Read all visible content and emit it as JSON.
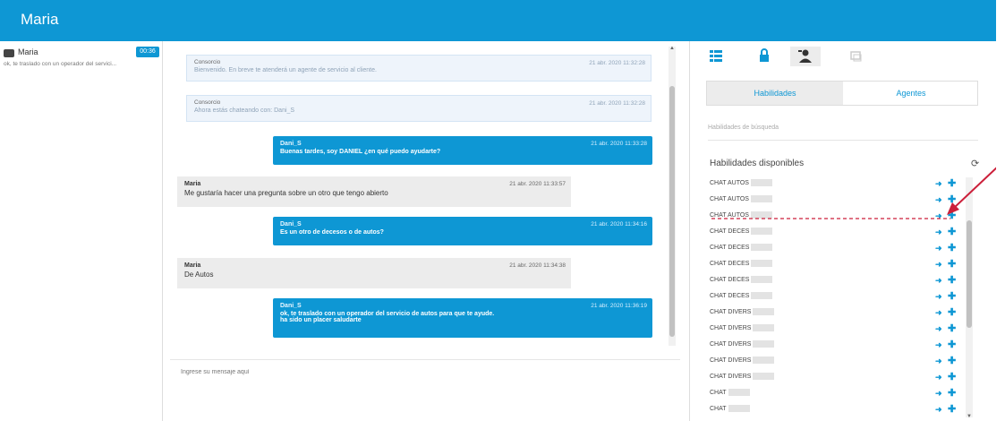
{
  "app": {
    "title": "Maria",
    "accent": "#0e97d4",
    "annotation_color": "#cc1f3a"
  },
  "conversations": [
    {
      "name": "Maria",
      "badge": "00:36",
      "preview": "ok, te traslado con un operador del servici..."
    }
  ],
  "chat": {
    "messages": [
      {
        "type": "system",
        "author": "Consorcio",
        "time": "21 abr. 2020 11:32:28",
        "text": "Bienvenido. En breve te atenderá un agente de servicio al cliente."
      },
      {
        "type": "system",
        "author": "Consorcio",
        "time": "21 abr. 2020 11:32:28",
        "text": "Ahora estás chateando con: Dani_S"
      },
      {
        "type": "outgoing",
        "author": "Dani_S",
        "time": "21 abr. 2020 11:33:28",
        "text": "Buenas tardes, soy DANIEL ¿en qué puedo ayudarte?"
      },
      {
        "type": "incoming",
        "author": "Maria",
        "time": "21 abr. 2020 11:33:57",
        "text": "Me gustaría hacer una pregunta sobre un otro que tengo abierto"
      },
      {
        "type": "outgoing",
        "author": "Dani_S",
        "time": "21 abr. 2020 11:34:16",
        "text": "Es un otro de decesos o de autos?"
      },
      {
        "type": "incoming",
        "author": "Maria",
        "time": "21 abr. 2020 11:34:38",
        "text": "De Autos"
      },
      {
        "type": "outgoing",
        "author": "Dani_S",
        "time": "21 abr. 2020 11:36:19",
        "text": "ok, te traslado con un operador del servicio de autos para que te ayude.",
        "text2": "ha sido un placer saludarte"
      }
    ],
    "composer_placeholder": "Ingrese su mensaje aquí"
  },
  "right": {
    "icons": [
      {
        "name": "list-icon",
        "glyph": "☰"
      },
      {
        "name": "lock-icon",
        "glyph": "🔒"
      },
      {
        "name": "user-transfer-icon",
        "glyph": "👤"
      },
      {
        "name": "window-icon",
        "glyph": "⧉"
      }
    ],
    "tabs": [
      "Habilidades",
      "Agentes"
    ],
    "search_placeholder": "Habilidades de búsqueda",
    "section_title": "Habilidades disponibles",
    "refresh_icon": "⟳",
    "skills": [
      "CHAT AUTOS",
      "CHAT AUTOS",
      "CHAT AUTOS",
      "CHAT DECES",
      "CHAT DECES",
      "CHAT DECES",
      "CHAT DECES",
      "CHAT DECES",
      "CHAT DIVERS",
      "CHAT DIVERS",
      "CHAT DIVERS",
      "CHAT DIVERS",
      "CHAT DIVERS",
      "CHAT",
      "CHAT"
    ],
    "arrow_glyph": "➜",
    "plus_glyph": "✚"
  }
}
